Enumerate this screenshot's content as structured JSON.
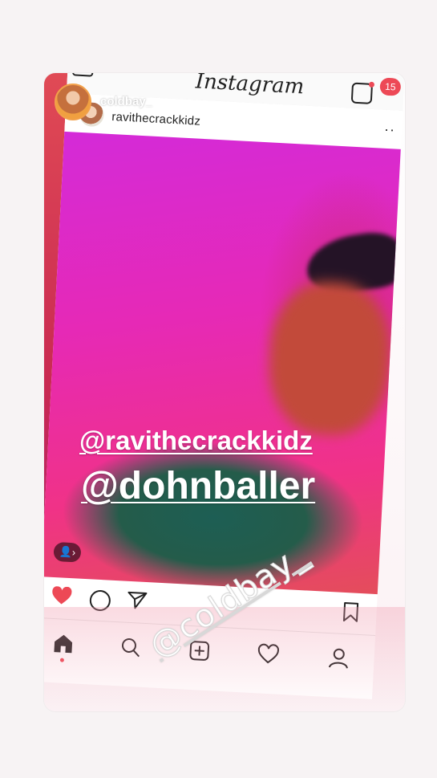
{
  "story": {
    "username": "coldbay_",
    "mention_1": "@ravithecrackkidz",
    "mention_2": "@dohnballer",
    "sticker_text": "@coldbay_"
  },
  "feed": {
    "logo": "Instagram",
    "notification_count": "15",
    "post_username": "ravithecrackkidz",
    "more_label": "··"
  },
  "icons": {
    "heart": "heart-filled-icon",
    "comment": "comment-icon",
    "share": "share-icon",
    "save": "bookmark-icon",
    "nav": [
      "home-icon",
      "search-icon",
      "add-icon",
      "heart-icon",
      "profile-icon"
    ]
  },
  "colors": {
    "like_red": "#ed4956",
    "story_ring": "#f2a14a"
  }
}
